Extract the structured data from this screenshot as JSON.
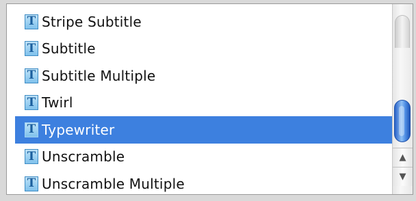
{
  "list": {
    "items": [
      {
        "label": "Stripe Subtitle",
        "icon": "text-icon",
        "selected": false
      },
      {
        "label": "Subtitle",
        "icon": "text-icon",
        "selected": false
      },
      {
        "label": "Subtitle Multiple",
        "icon": "text-icon",
        "selected": false
      },
      {
        "label": "Twirl",
        "icon": "text-icon",
        "selected": false
      },
      {
        "label": "Typewriter",
        "icon": "text-icon",
        "selected": true
      },
      {
        "label": "Unscramble",
        "icon": "text-icon",
        "selected": false
      },
      {
        "label": "Unscramble Multiple",
        "icon": "text-icon",
        "selected": false
      }
    ],
    "icon_glyph": "T"
  },
  "scrollbar": {
    "up_glyph": "▲",
    "down_glyph": "▼"
  },
  "colors": {
    "selection": "#3d80df",
    "icon_fill": "#8fcbf0",
    "scroll_thumb": "#3a7ad6"
  }
}
